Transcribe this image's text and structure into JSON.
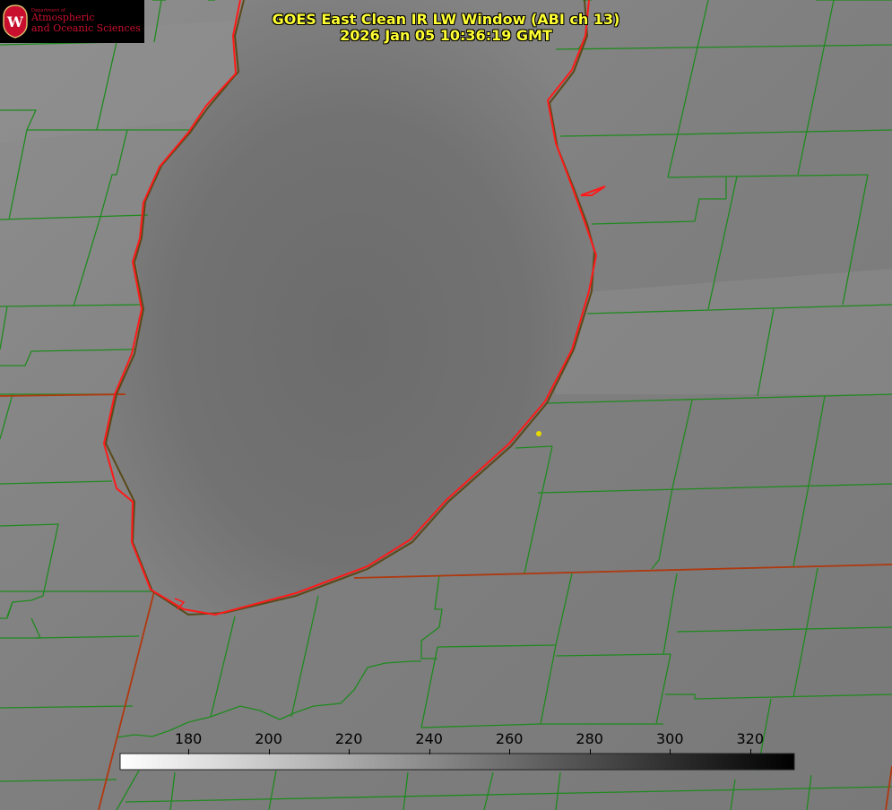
{
  "title_line1": "GOES East Clean IR LW Window (ABI ch 13)",
  "title_line2": "2026 Jan 05 10:36:19 GMT",
  "logo": {
    "small": "Department of",
    "line1": "Atmospheric",
    "line2": "and Oceanic Sciences",
    "letter": "W"
  },
  "colorbar": {
    "ticks": [
      "180",
      "200",
      "220",
      "240",
      "260",
      "280",
      "300",
      "320"
    ],
    "tick_values": [
      180,
      200,
      220,
      240,
      260,
      280,
      300,
      320
    ],
    "range": [
      163,
      331
    ]
  },
  "colors": {
    "county_lines": "#1f8a1f",
    "coastline": "#ff2020",
    "state_lines": "#b0380f",
    "title": "#ffff33",
    "logo": "#c8102e"
  }
}
